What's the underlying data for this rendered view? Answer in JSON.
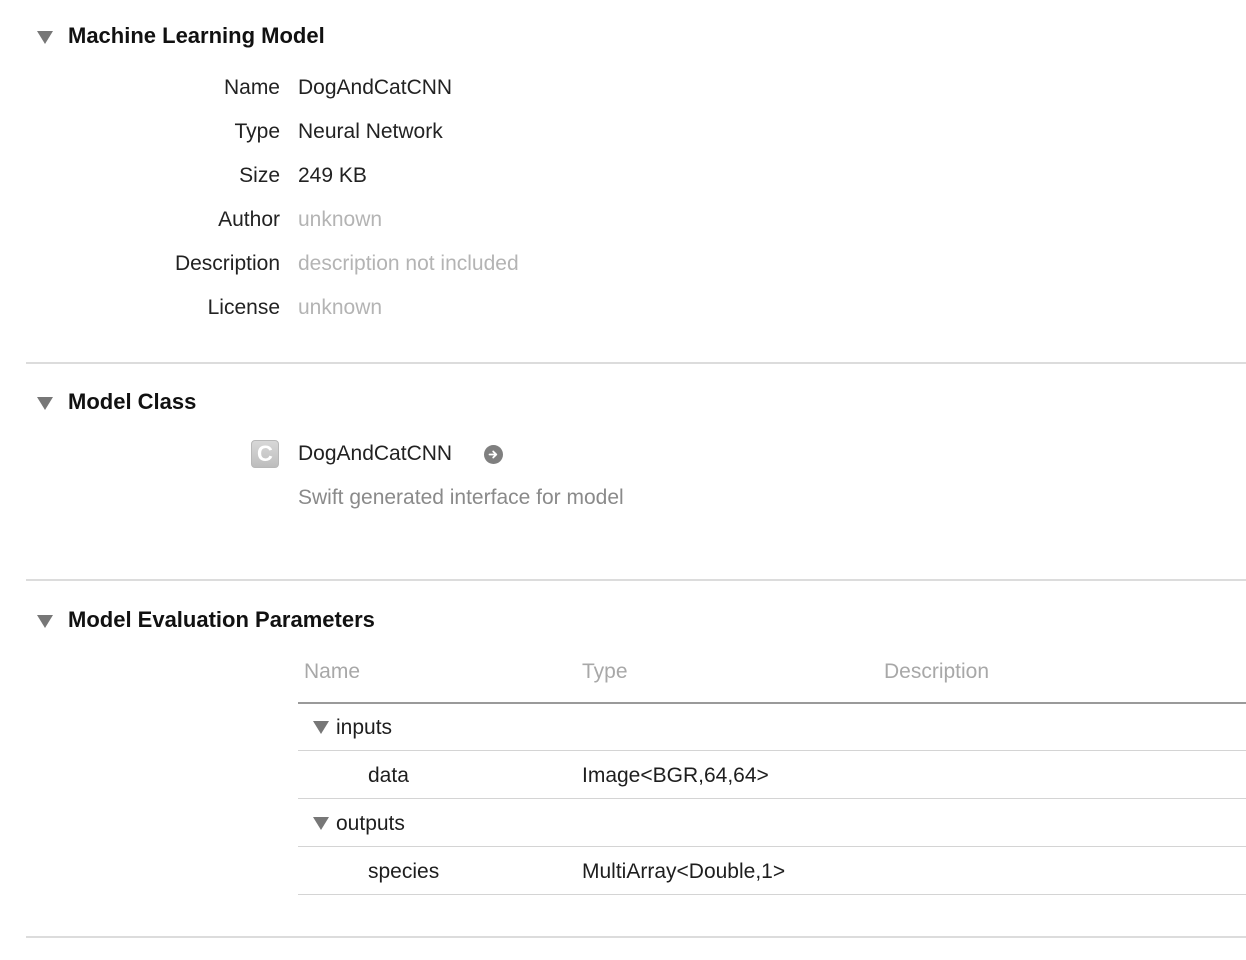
{
  "machine_learning_model": {
    "title": "Machine Learning Model",
    "fields": [
      {
        "label": "Name",
        "value": "DogAndCatCNN"
      },
      {
        "label": "Type",
        "value": "Neural Network"
      },
      {
        "label": "Size",
        "value": "249 KB"
      },
      {
        "label": "Author",
        "value": "unknown"
      },
      {
        "label": "Description",
        "value": "description not included"
      },
      {
        "label": "License",
        "value": "unknown"
      }
    ]
  },
  "model_class": {
    "title": "Model Class",
    "icon_letter": "C",
    "class_name": "DogAndCatCNN",
    "subtitle": "Swift generated interface for model"
  },
  "evaluation_parameters": {
    "title": "Model Evaluation Parameters",
    "columns": {
      "name": "Name",
      "type": "Type",
      "description": "Description"
    },
    "groups": [
      {
        "label": "inputs",
        "rows": [
          {
            "name": "data",
            "type": "Image<BGR,64,64>",
            "description": ""
          }
        ]
      },
      {
        "label": "outputs",
        "rows": [
          {
            "name": "species",
            "type": "MultiArray<Double,1>",
            "description": ""
          }
        ]
      }
    ]
  },
  "icons": {
    "disclosure": "disclosure-triangle-icon",
    "class": "class-c-icon",
    "navigate": "jump-arrow-icon"
  },
  "colors": {
    "muted_text": "#b4b4b4",
    "disclosure": "#777777",
    "divider": "#dcdcdc"
  }
}
